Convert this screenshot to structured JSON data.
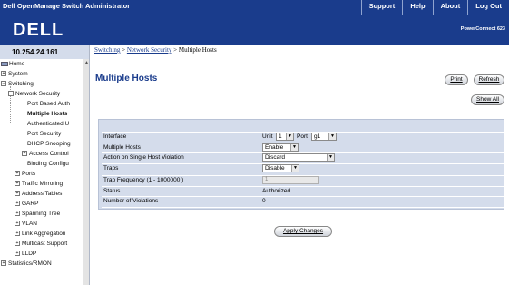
{
  "app": {
    "title": "Dell OpenManage Switch Administrator",
    "nav_links": [
      "Support",
      "Help",
      "About",
      "Log Out"
    ],
    "logo_text": "DELL",
    "model": "PowerConnect 623"
  },
  "ip_address": "10.254.24.161",
  "breadcrumb": {
    "items": [
      "Switching",
      "Network Security"
    ],
    "separator": ">",
    "current": "Multiple Hosts"
  },
  "sidebar": {
    "items": [
      {
        "label": "Home",
        "toggle": ""
      },
      {
        "label": "System",
        "toggle": "+"
      },
      {
        "label": "Switching",
        "toggle": "−"
      },
      {
        "label": "Network Security",
        "toggle": "−"
      },
      {
        "label": "Port Based Auth",
        "toggle": ""
      },
      {
        "label": "Multiple Hosts",
        "toggle": "",
        "selected": true
      },
      {
        "label": "Authenticated U",
        "toggle": ""
      },
      {
        "label": "Port Security",
        "toggle": ""
      },
      {
        "label": "DHCP Snooping",
        "toggle": ""
      },
      {
        "label": "Access Control",
        "toggle": "+"
      },
      {
        "label": "Binding Configu",
        "toggle": ""
      },
      {
        "label": "Ports",
        "toggle": "+"
      },
      {
        "label": "Traffic Mirroring",
        "toggle": "+"
      },
      {
        "label": "Address Tables",
        "toggle": "+"
      },
      {
        "label": "GARP",
        "toggle": "+"
      },
      {
        "label": "Spanning Tree",
        "toggle": "+"
      },
      {
        "label": "VLAN",
        "toggle": "+"
      },
      {
        "label": "Link Aggregation",
        "toggle": "+"
      },
      {
        "label": "Multicast Support",
        "toggle": "+"
      },
      {
        "label": "LLDP",
        "toggle": "+"
      },
      {
        "label": "Statistics/RMON",
        "toggle": "+"
      }
    ]
  },
  "main": {
    "title": "Multiple Hosts",
    "buttons": {
      "print": "Print",
      "refresh": "Refresh",
      "show_all": "Show All",
      "apply": "Apply Changes"
    },
    "form": {
      "interface_label": "Interface",
      "unit_label": "Unit",
      "unit_value": "1",
      "port_label": "Port",
      "port_value": "g1",
      "multiple_hosts_label": "Multiple Hosts",
      "multiple_hosts_value": "Enable",
      "action_label": "Action on Single Host Violation",
      "action_value": "Discard",
      "traps_label": "Traps",
      "traps_value": "Disable",
      "trap_freq_label": "Trap Frequency (1 - 1000000 )",
      "trap_freq_value": "1",
      "status_label": "Status",
      "status_value": "Authorized",
      "violations_label": "Number of Violations",
      "violations_value": "0"
    }
  },
  "colors": {
    "brand_blue": "#1a3c8c",
    "panel_bg": "#d4dceb"
  }
}
